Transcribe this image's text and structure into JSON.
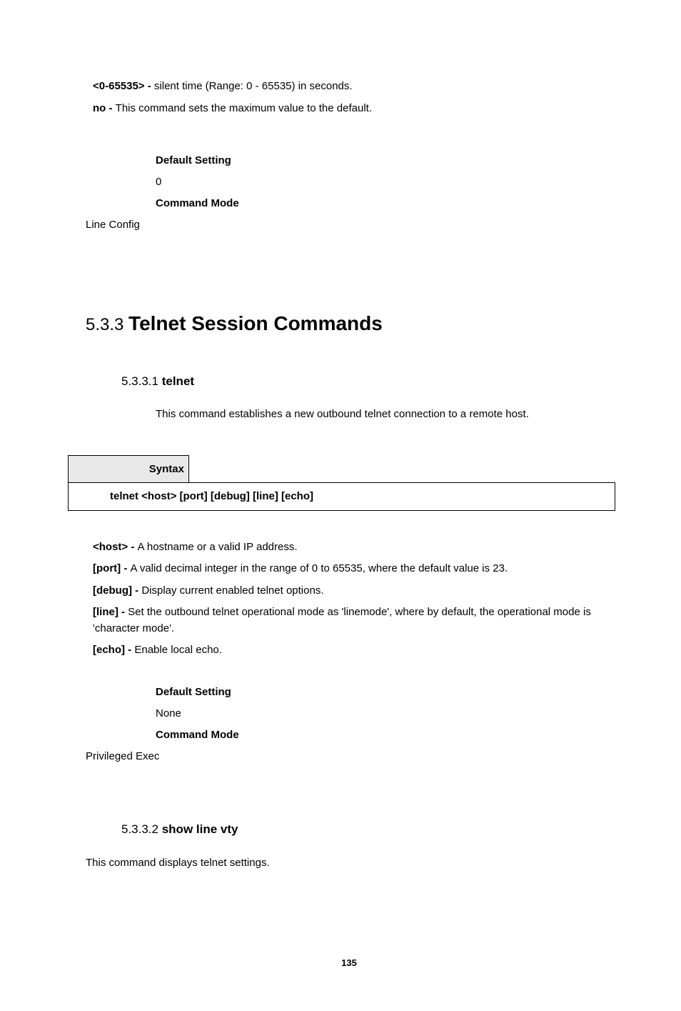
{
  "top_params": {
    "p1_label": "<0-65535> - ",
    "p1_text": "silent time (Range: 0 - 65535) in seconds.",
    "p2_label": "no - ",
    "p2_text": "This command sets the maximum value to the default."
  },
  "top_settings": {
    "default_label": "Default Setting",
    "default_value": "0",
    "mode_label": "Command Mode",
    "mode_value": "Line Config"
  },
  "section": {
    "num": "5.3.3 ",
    "title": "Telnet Session Commands"
  },
  "sub1": {
    "num": "5.3.3.1 ",
    "name": "telnet",
    "desc": "This command establishes a new outbound telnet connection to a remote host."
  },
  "syntax": {
    "label": "Syntax",
    "cmd": "telnet <host> [port] [debug] [line] [echo]"
  },
  "mid_params": {
    "p1_label": "<host> - ",
    "p1_text": "A hostname or a valid IP address.",
    "p2_label": "[port] - ",
    "p2_text": "A valid decimal integer in the range of 0 to 65535, where the default value is 23.",
    "p3_label": "[debug] - ",
    "p3_text": "Display current enabled telnet options.",
    "p4_label": "[line] - ",
    "p4_text": "Set the outbound telnet operational mode as 'linemode', where by default, the operational mode is 'character mode'.",
    "p5_label": "[echo] - ",
    "p5_text": "Enable local echo."
  },
  "mid_settings": {
    "default_label": "Default Setting",
    "default_value": "None",
    "mode_label": "Command Mode",
    "mode_value": "Privileged Exec"
  },
  "sub2": {
    "num": "5.3.3.2 ",
    "name": "show line vty",
    "desc": "This command displays telnet settings."
  },
  "page_number": "135"
}
